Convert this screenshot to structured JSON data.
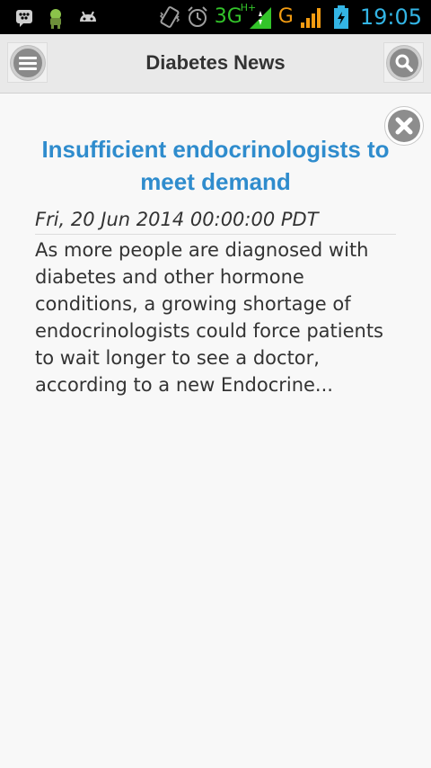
{
  "status_bar": {
    "network": "3G",
    "network_plus": "H+",
    "network2": "G",
    "time": "19:05",
    "icons": [
      "bbm-icon",
      "android-robot-icon",
      "android-game-icon",
      "vibrate-icon",
      "alarm-icon",
      "signal-icon",
      "signal-icon",
      "battery-charging-icon"
    ],
    "accent_color": "#33b5e5",
    "network_color": "#33c42a"
  },
  "header": {
    "title": "Diabetes News",
    "menu_icon": "menu-icon",
    "search_icon": "search-icon"
  },
  "article": {
    "title": "Insufficient endocrinologists to meet demand",
    "date": "Fri, 20 Jun 2014 00:00:00 PDT",
    "body": "As more people are diagnosed with diabetes and other hormone conditions, a growing shortage of endocrinologists could force patients to wait longer to see a doctor, according to a new Endocrine...",
    "title_color": "#2f8ccd",
    "close_icon": "close-icon"
  }
}
